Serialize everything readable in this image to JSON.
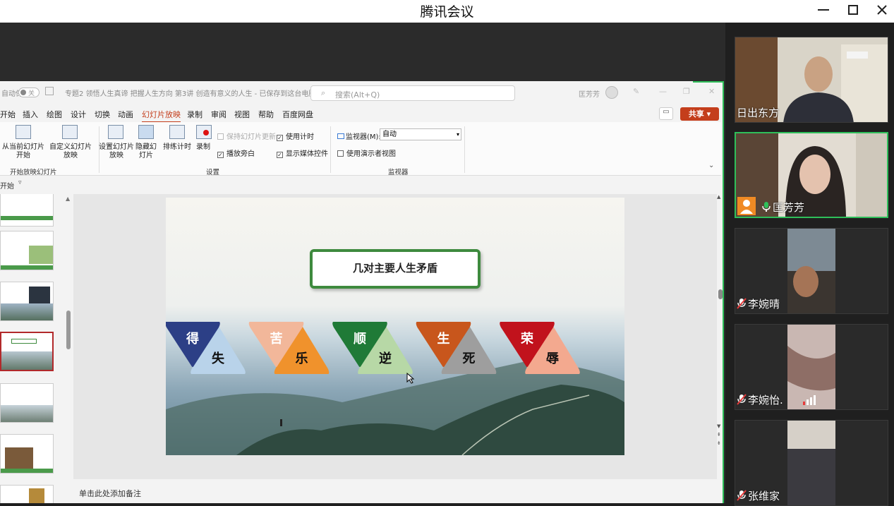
{
  "window": {
    "title": "腾讯会议"
  },
  "ppt": {
    "autosave_label": "自动保存",
    "autosave_state": "关",
    "doc_title": "专题2 领悟人生真谛 把握人生方向 第3讲 创造有意义的人生 - 已保存到这台电脑",
    "search_placeholder": "搜索(Alt+Q)",
    "user": "匡芳芳",
    "share_label": "共享",
    "tabs": [
      "开始",
      "插入",
      "绘图",
      "设计",
      "切换",
      "动画",
      "幻灯片放映",
      "录制",
      "审阅",
      "视图",
      "帮助",
      "百度网盘"
    ],
    "active_tab": "幻灯片放映",
    "ribbon": {
      "from_current": "从当前幻灯片开始",
      "custom": "自定义幻灯片放映",
      "group_start": "开始放映幻灯片",
      "setup": "设置幻灯片放映",
      "hide": "隐藏幻灯片",
      "rehearse": "排练计时",
      "record": "录制",
      "keep_updated": "保持幻灯片更新",
      "use_timings": "使用计时",
      "play_narration": "播放旁白",
      "show_media": "显示媒体控件",
      "group_setup": "设置",
      "monitor_label": "监视器(M):",
      "monitor_value": "自动",
      "presenter_view": "使用演示者视图",
      "group_monitor": "监视器"
    },
    "qat_label": "开始",
    "notes_placeholder": "单击此处添加备注"
  },
  "slide": {
    "title": "几对主要人生矛盾",
    "pairs": [
      {
        "a": "得",
        "b": "失",
        "color_a": "#2c3f86",
        "color_b": "#b9d3ea"
      },
      {
        "a": "苦",
        "b": "乐",
        "color_a": "#f2b79a",
        "color_b": "#f0922c"
      },
      {
        "a": "顺",
        "b": "逆",
        "color_a": "#1f7a37",
        "color_b": "#b7d8a6"
      },
      {
        "a": "生",
        "b": "死",
        "color_a": "#c8561c",
        "color_b": "#9e9e9e"
      },
      {
        "a": "荣",
        "b": "辱",
        "color_a": "#c1121c",
        "color_b": "#f3a98f"
      }
    ]
  },
  "participants": [
    {
      "name": "日出东方",
      "muted": false,
      "speaking": false
    },
    {
      "name": "匡芳芳",
      "muted": false,
      "speaking": true
    },
    {
      "name": "李婉晴",
      "muted": true,
      "speaking": false
    },
    {
      "name": "李婉怡.",
      "muted": true,
      "speaking": false
    },
    {
      "name": "张维家",
      "muted": true,
      "speaking": false
    }
  ]
}
